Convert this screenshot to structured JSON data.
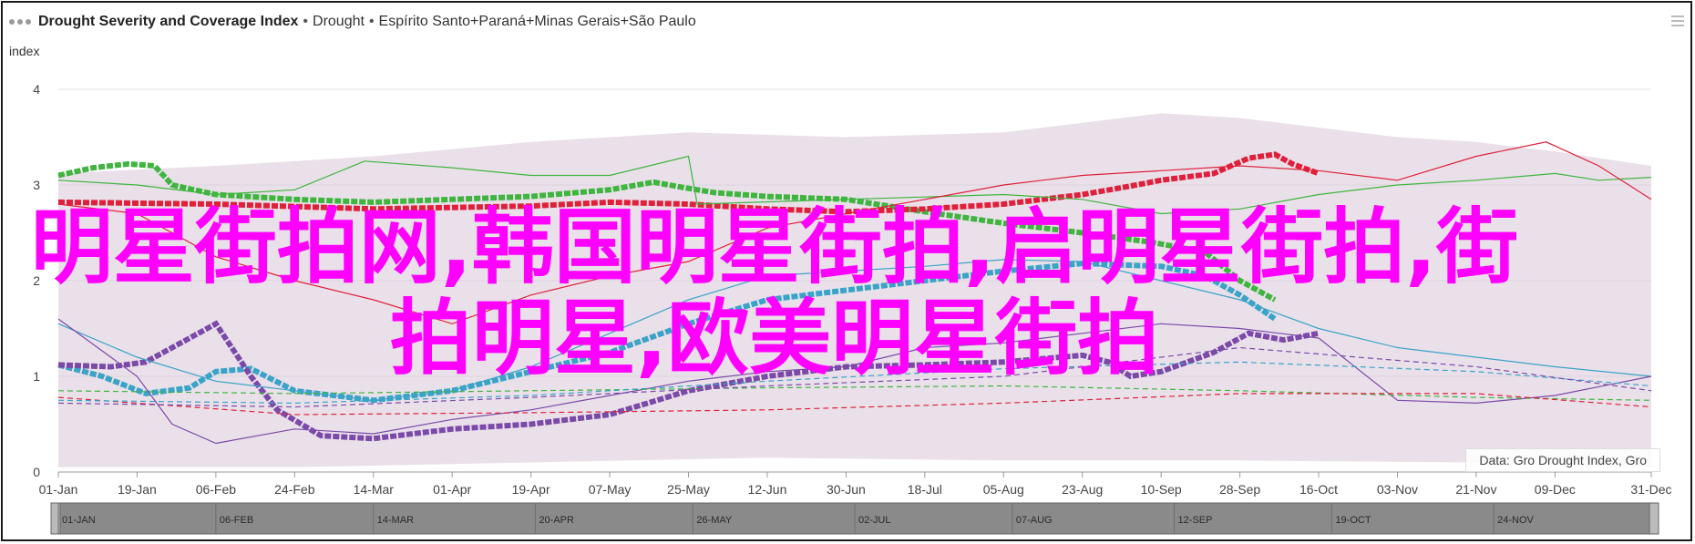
{
  "header": {
    "title": "Drought Severity and Coverage Index",
    "separator1": "•",
    "subtitle1": "Drought",
    "separator2": "•",
    "subtitle2": "Espírito Santo+Paraná+Minas Gerais+São Paulo"
  },
  "overlay_text": "明星街拍网,韩国明星街拍,启明星街拍,街拍明星,欧美明星街拍",
  "source": "Data: Gro Drought Index, Gro",
  "navigator": {
    "labels": [
      "01-JAN",
      "06-FEB",
      "14-MAR",
      "20-APR",
      "26-MAY",
      "02-JUL",
      "07-AUG",
      "12-SEP",
      "19-OCT",
      "24-NOV"
    ]
  },
  "colors": {
    "bands": "#d9c7d9",
    "green": "#3fb53f",
    "red": "#e0203a",
    "blue": "#3aa3c8",
    "purple": "#7b4aa8",
    "navigator": "#8a8a8a"
  },
  "chart_data": {
    "type": "line",
    "ylabel": "index",
    "ylim": [
      0,
      4
    ],
    "yticks": [
      0,
      1,
      2,
      3,
      4
    ],
    "x_ticks": [
      "01-Jan",
      "19-Jan",
      "06-Feb",
      "24-Feb",
      "14-Mar",
      "01-Apr",
      "19-Apr",
      "07-May",
      "25-May",
      "12-Jun",
      "30-Jun",
      "18-Jul",
      "05-Aug",
      "23-Aug",
      "10-Sep",
      "28-Sep",
      "16-Oct",
      "03-Nov",
      "21-Nov",
      "09-Dec",
      "31-Dec"
    ],
    "x_days": [
      0,
      18,
      36,
      54,
      72,
      90,
      108,
      126,
      144,
      162,
      180,
      198,
      216,
      234,
      252,
      270,
      288,
      306,
      324,
      342,
      364
    ],
    "series": [
      {
        "role": "bold",
        "color": "#3fb53f",
        "points": [
          [
            0,
            3.1
          ],
          [
            8,
            3.18
          ],
          [
            16,
            3.22
          ],
          [
            22,
            3.2
          ],
          [
            26,
            3.0
          ],
          [
            36,
            2.9
          ],
          [
            54,
            2.85
          ],
          [
            72,
            2.82
          ],
          [
            90,
            2.85
          ],
          [
            108,
            2.88
          ],
          [
            126,
            2.95
          ],
          [
            136,
            3.03
          ],
          [
            142,
            2.98
          ],
          [
            150,
            2.92
          ],
          [
            162,
            2.88
          ],
          [
            180,
            2.85
          ],
          [
            198,
            2.72
          ],
          [
            216,
            2.6
          ],
          [
            234,
            2.5
          ],
          [
            250,
            2.4
          ],
          [
            262,
            2.3
          ],
          [
            270,
            2.0
          ],
          [
            278,
            1.8
          ]
        ]
      },
      {
        "role": "bold",
        "color": "#e0203a",
        "points": [
          [
            0,
            2.82
          ],
          [
            36,
            2.8
          ],
          [
            72,
            2.75
          ],
          [
            108,
            2.78
          ],
          [
            126,
            2.82
          ],
          [
            144,
            2.8
          ],
          [
            162,
            2.75
          ],
          [
            180,
            2.72
          ],
          [
            198,
            2.75
          ],
          [
            216,
            2.8
          ],
          [
            234,
            2.9
          ],
          [
            244,
            2.98
          ],
          [
            252,
            3.05
          ],
          [
            264,
            3.12
          ],
          [
            272,
            3.28
          ],
          [
            278,
            3.32
          ],
          [
            282,
            3.22
          ],
          [
            288,
            3.12
          ]
        ]
      },
      {
        "role": "bold",
        "color": "#3aa3c8",
        "points": [
          [
            0,
            1.12
          ],
          [
            10,
            1.0
          ],
          [
            20,
            0.82
          ],
          [
            30,
            0.88
          ],
          [
            36,
            1.05
          ],
          [
            44,
            1.08
          ],
          [
            54,
            0.85
          ],
          [
            72,
            0.75
          ],
          [
            90,
            0.85
          ],
          [
            108,
            1.05
          ],
          [
            126,
            1.25
          ],
          [
            144,
            1.55
          ],
          [
            162,
            1.8
          ],
          [
            180,
            1.9
          ],
          [
            198,
            2.0
          ],
          [
            216,
            2.1
          ],
          [
            234,
            2.18
          ],
          [
            252,
            2.15
          ],
          [
            262,
            2.05
          ],
          [
            270,
            1.85
          ],
          [
            278,
            1.6
          ]
        ]
      },
      {
        "role": "bold",
        "color": "#7b4aa8",
        "points": [
          [
            0,
            1.12
          ],
          [
            12,
            1.1
          ],
          [
            20,
            1.15
          ],
          [
            30,
            1.4
          ],
          [
            36,
            1.55
          ],
          [
            44,
            1.0
          ],
          [
            50,
            0.65
          ],
          [
            60,
            0.38
          ],
          [
            72,
            0.35
          ],
          [
            90,
            0.45
          ],
          [
            108,
            0.5
          ],
          [
            126,
            0.6
          ],
          [
            144,
            0.85
          ],
          [
            162,
            1.0
          ],
          [
            180,
            1.1
          ],
          [
            198,
            1.12
          ],
          [
            216,
            1.15
          ],
          [
            234,
            1.22
          ],
          [
            240,
            1.15
          ],
          [
            245,
            1.0
          ],
          [
            252,
            1.05
          ],
          [
            264,
            1.25
          ],
          [
            272,
            1.45
          ],
          [
            280,
            1.38
          ],
          [
            288,
            1.45
          ]
        ]
      },
      {
        "role": "thin",
        "color": "#3fb53f",
        "points": [
          [
            0,
            3.05
          ],
          [
            18,
            3.0
          ],
          [
            36,
            2.9
          ],
          [
            54,
            2.95
          ],
          [
            70,
            3.25
          ],
          [
            90,
            3.18
          ],
          [
            108,
            3.1
          ],
          [
            126,
            3.1
          ],
          [
            144,
            3.3
          ],
          [
            146,
            2.8
          ],
          [
            180,
            2.85
          ],
          [
            216,
            2.9
          ],
          [
            234,
            2.85
          ],
          [
            252,
            2.7
          ],
          [
            270,
            2.75
          ],
          [
            288,
            2.9
          ],
          [
            306,
            3.0
          ],
          [
            324,
            3.05
          ],
          [
            342,
            3.12
          ],
          [
            352,
            3.05
          ],
          [
            364,
            3.08
          ]
        ]
      },
      {
        "role": "thin",
        "color": "#e0203a",
        "points": [
          [
            0,
            2.8
          ],
          [
            18,
            2.7
          ],
          [
            36,
            2.25
          ],
          [
            54,
            2.0
          ],
          [
            72,
            1.8
          ],
          [
            90,
            1.55
          ],
          [
            108,
            1.85
          ],
          [
            126,
            2.05
          ],
          [
            144,
            2.2
          ],
          [
            162,
            2.55
          ],
          [
            180,
            2.7
          ],
          [
            198,
            2.85
          ],
          [
            216,
            3.0
          ],
          [
            234,
            3.1
          ],
          [
            252,
            3.15
          ],
          [
            270,
            3.2
          ],
          [
            288,
            3.15
          ],
          [
            306,
            3.05
          ],
          [
            324,
            3.3
          ],
          [
            340,
            3.45
          ],
          [
            352,
            3.2
          ],
          [
            364,
            2.85
          ]
        ]
      },
      {
        "role": "thin",
        "color": "#3aa3c8",
        "points": [
          [
            0,
            1.55
          ],
          [
            18,
            1.2
          ],
          [
            36,
            0.95
          ],
          [
            54,
            0.85
          ],
          [
            72,
            0.75
          ],
          [
            90,
            0.85
          ],
          [
            108,
            1.1
          ],
          [
            126,
            1.45
          ],
          [
            144,
            1.8
          ],
          [
            162,
            2.05
          ],
          [
            180,
            2.1
          ],
          [
            198,
            2.15
          ],
          [
            216,
            2.22
          ],
          [
            234,
            2.2
          ],
          [
            252,
            2.0
          ],
          [
            270,
            1.8
          ],
          [
            288,
            1.5
          ],
          [
            306,
            1.3
          ],
          [
            324,
            1.2
          ],
          [
            342,
            1.1
          ],
          [
            364,
            1.0
          ]
        ]
      },
      {
        "role": "thin",
        "color": "#7b4aa8",
        "points": [
          [
            0,
            1.6
          ],
          [
            18,
            1.0
          ],
          [
            26,
            0.5
          ],
          [
            36,
            0.3
          ],
          [
            54,
            0.45
          ],
          [
            72,
            0.4
          ],
          [
            90,
            0.55
          ],
          [
            108,
            0.65
          ],
          [
            126,
            0.8
          ],
          [
            144,
            0.95
          ],
          [
            162,
            1.05
          ],
          [
            180,
            1.1
          ],
          [
            198,
            1.3
          ],
          [
            216,
            1.35
          ],
          [
            234,
            1.45
          ],
          [
            252,
            1.55
          ],
          [
            270,
            1.5
          ],
          [
            288,
            1.4
          ],
          [
            306,
            0.75
          ],
          [
            324,
            0.72
          ],
          [
            342,
            0.8
          ],
          [
            364,
            1.0
          ]
        ]
      },
      {
        "role": "dashed",
        "color": "#3fb53f",
        "points": [
          [
            0,
            0.85
          ],
          [
            54,
            0.82
          ],
          [
            108,
            0.85
          ],
          [
            162,
            0.88
          ],
          [
            216,
            0.9
          ],
          [
            270,
            0.85
          ],
          [
            324,
            0.78
          ],
          [
            364,
            0.75
          ]
        ]
      },
      {
        "role": "dashed",
        "color": "#e0203a",
        "points": [
          [
            0,
            0.78
          ],
          [
            54,
            0.6
          ],
          [
            108,
            0.62
          ],
          [
            162,
            0.65
          ],
          [
            216,
            0.72
          ],
          [
            270,
            0.82
          ],
          [
            324,
            0.82
          ],
          [
            364,
            0.68
          ]
        ]
      },
      {
        "role": "dashed",
        "color": "#3aa3c8",
        "points": [
          [
            0,
            0.75
          ],
          [
            54,
            0.72
          ],
          [
            108,
            0.8
          ],
          [
            162,
            0.95
          ],
          [
            216,
            1.08
          ],
          [
            270,
            1.15
          ],
          [
            324,
            1.05
          ],
          [
            364,
            0.9
          ]
        ]
      },
      {
        "role": "dashed",
        "color": "#7b4aa8",
        "points": [
          [
            0,
            0.72
          ],
          [
            54,
            0.68
          ],
          [
            108,
            0.78
          ],
          [
            162,
            0.9
          ],
          [
            216,
            1.0
          ],
          [
            270,
            1.3
          ],
          [
            324,
            1.1
          ],
          [
            364,
            0.85
          ]
        ]
      }
    ],
    "bands": [
      {
        "upper": [
          [
            0,
            3.12
          ],
          [
            36,
            3.2
          ],
          [
            72,
            3.3
          ],
          [
            108,
            3.45
          ],
          [
            144,
            3.55
          ],
          [
            180,
            3.5
          ],
          [
            216,
            3.55
          ],
          [
            234,
            3.65
          ],
          [
            252,
            3.75
          ],
          [
            270,
            3.7
          ],
          [
            288,
            3.6
          ],
          [
            306,
            3.5
          ],
          [
            324,
            3.45
          ],
          [
            342,
            3.35
          ],
          [
            364,
            3.2
          ]
        ],
        "lower": [
          [
            0,
            0.05
          ],
          [
            54,
            0.05
          ],
          [
            108,
            0.1
          ],
          [
            162,
            0.15
          ],
          [
            216,
            0.12
          ],
          [
            270,
            0.12
          ],
          [
            324,
            0.1
          ],
          [
            364,
            0.05
          ]
        ]
      }
    ],
    "grid": true,
    "legend": "none"
  }
}
